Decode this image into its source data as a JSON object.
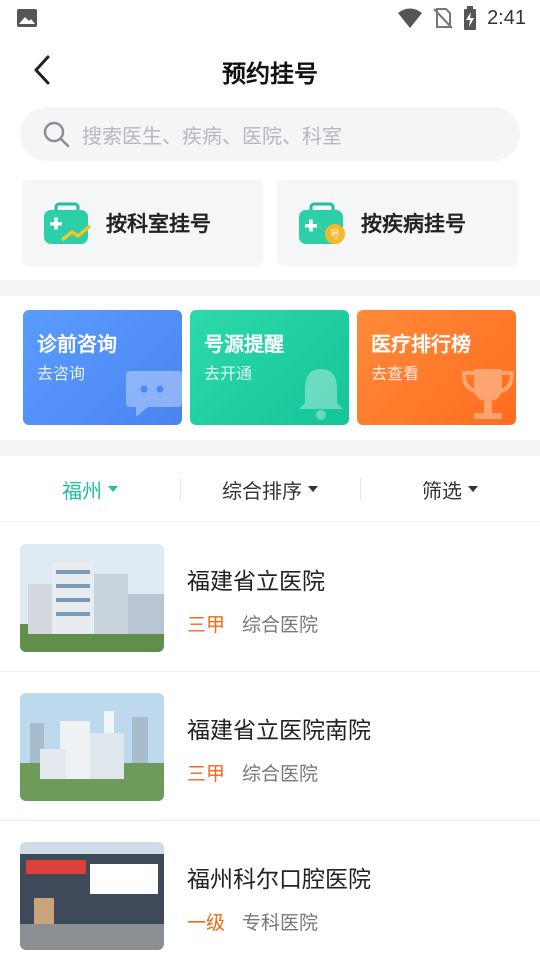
{
  "status_bar": {
    "time": "2:41"
  },
  "header": {
    "title": "预约挂号"
  },
  "search": {
    "placeholder": "搜索医生、疾病、医院、科室"
  },
  "quick_entries": [
    {
      "label": "按科室挂号",
      "icon": "department-kit-icon"
    },
    {
      "label": "按疾病挂号",
      "icon": "disease-kit-icon"
    }
  ],
  "service_cards": [
    {
      "title": "诊前咨询",
      "subtitle": "去咨询",
      "color": "#4f8ff7",
      "icon": "chat-bubble-icon"
    },
    {
      "title": "号源提醒",
      "subtitle": "去开通",
      "color": "#1fcf9f",
      "icon": "bell-icon"
    },
    {
      "title": "医疗排行榜",
      "subtitle": "去查看",
      "color": "#ff7a2a",
      "icon": "trophy-icon"
    }
  ],
  "filters": [
    {
      "label": "福州",
      "active": true
    },
    {
      "label": "综合排序",
      "active": false
    },
    {
      "label": "筛选",
      "active": false
    }
  ],
  "hospitals": [
    {
      "name": "福建省立医院",
      "level": "三甲",
      "type": "综合医院"
    },
    {
      "name": "福建省立医院南院",
      "level": "三甲",
      "type": "综合医院"
    },
    {
      "name": "福州科尔口腔医院",
      "level": "一级",
      "type": "专科医院"
    }
  ],
  "colors": {
    "accent": "#1fbf9f",
    "level": "#f06a1a"
  }
}
